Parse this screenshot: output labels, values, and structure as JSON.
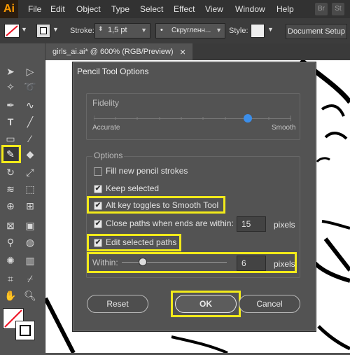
{
  "app": {
    "logo": "Ai",
    "bridge": "Br",
    "stock": "St"
  },
  "menu": [
    "File",
    "Edit",
    "Object",
    "Type",
    "Select",
    "Effect",
    "View",
    "Window",
    "Help"
  ],
  "control_bar": {
    "stroke_label": "Stroke:",
    "stroke_value": "1,5 pt",
    "brush_value": "Скругленн...",
    "style_label": "Style:",
    "document_setup": "Document Setup"
  },
  "document_tab": {
    "title": "girls_ai.ai* @ 600% (RGB/Preview)",
    "close": "×"
  },
  "dialog": {
    "title": "Pencil Tool Options",
    "fidelity": {
      "label": "Fidelity",
      "min_label": "Accurate",
      "max_label": "Smooth",
      "value_fraction": 0.78
    },
    "options_label": "Options",
    "fill_new": {
      "label": "Fill new pencil strokes",
      "checked": false
    },
    "keep_selected": {
      "label": "Keep selected",
      "checked": true
    },
    "alt_key": {
      "label": "Alt key toggles to Smooth Tool",
      "checked": true
    },
    "close_paths": {
      "label": "Close paths when ends are within:",
      "checked": true,
      "value": "15",
      "unit": "pixels"
    },
    "edit_selected": {
      "label": "Edit selected paths",
      "checked": true
    },
    "within": {
      "label": "Within:",
      "value": "6",
      "unit": "pixels",
      "slider_fraction": 0.2
    },
    "buttons": {
      "reset": "Reset",
      "ok": "OK",
      "cancel": "Cancel"
    }
  },
  "colors": {
    "highlight": "#f2ea1a",
    "fidelity_thumb": "#3b8eea"
  }
}
